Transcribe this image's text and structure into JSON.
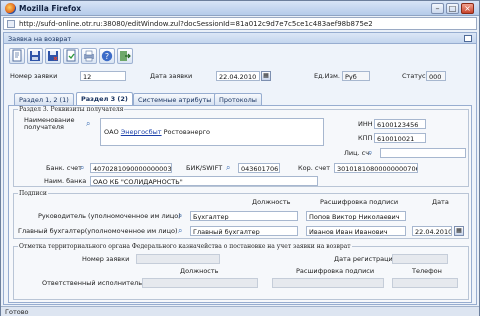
{
  "window": {
    "title": "Mozilla Firefox",
    "url": "http://sufd-online.otr.ru:38080/editWindow.zul?docSessionId=81a012c9d7e7c5ce1c483aef98b875e2"
  },
  "panel": {
    "title": "Заявка на возврат"
  },
  "toolbar": {
    "buttons": [
      "new-doc-icon",
      "save-icon",
      "save-close-icon",
      "print-icon",
      "help-icon",
      "exit-icon"
    ]
  },
  "header": {
    "number_label": "Номер заявки",
    "number_value": "12",
    "date_label": "Дата заявки",
    "date_value": "22.04.2010",
    "unit_label": "Ед.Изм.",
    "unit_value": "Руб",
    "status_label": "Статус",
    "status_value": "000"
  },
  "tabs": [
    {
      "label": "Раздел 1, 2 (1)"
    },
    {
      "label": "Раздел 3 (2)"
    },
    {
      "label": "Системные атрибуты"
    },
    {
      "label": "Протоколы"
    }
  ],
  "section3": {
    "title": "Раздел 3. Реквизиты получателя",
    "recipient_label_1": "Наименование",
    "recipient_label_2": "получателя",
    "recipient_prefix": "ОАО ",
    "recipient_link": "Энергосбыт",
    "recipient_suffix": " Ростовэнерго",
    "inn_label": "ИНН",
    "inn_value": "6100123456",
    "kpp_label": "КПП",
    "kpp_value": "610010021",
    "personal_label": "Лиц. сч.",
    "personal_value": "",
    "bank_account_label": "Банк. счет",
    "bank_account_value": "40702810900000000033",
    "bik_label": "БИК/SWIFT",
    "bik_value": "043601706",
    "corr_label": "Кор. счет",
    "corr_value": "30101810800000000706",
    "bank_name_label": "Наим. банка",
    "bank_name_value": "ОАО КБ \"СОЛИДАРНОСТЬ\""
  },
  "signatures": {
    "title": "Подписи",
    "col_position": "Должность",
    "col_name": "Расшифровка подписи",
    "col_date": "Дата",
    "head_label": "Руководитель (уполномоченное им лицо)",
    "head_position": "Бухгалтер",
    "head_name": "Попов Виктор Николаевич",
    "accountant_label": "Главный бухгалтер(уполномоченное им лицо)",
    "accountant_position": "Главный бухгалтер",
    "accountant_name": "Иванов Иван Иванович",
    "accountant_date": "22.04.2010"
  },
  "treasury": {
    "title": "Отметка территориального органа Федерального казначейства о постановке на учет заявки на возврат",
    "number_label": "Номер заявки",
    "reg_date_label": "Дата регистрации",
    "col_position": "Должность",
    "col_name": "Расшифровка подписи",
    "col_phone": "Телефон",
    "executor_label": "Ответственный исполнитель:"
  },
  "status": {
    "text": "Готово"
  }
}
